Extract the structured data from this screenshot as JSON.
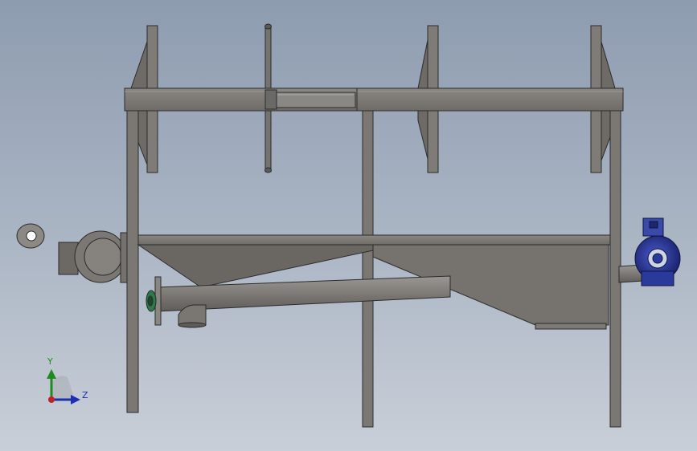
{
  "view": {
    "background_top": "#8e9cb0",
    "background_bottom": "#c9cfd8",
    "part_color": "#7d7a76",
    "part_edge": "#2b2b2b",
    "motor_color": "#2a3a9a",
    "flange_color": "#2e7a4a"
  },
  "triad": {
    "y_label": "Y",
    "z_label": "Z",
    "y_color": "#1f8a1f",
    "z_color": "#1c2fb0",
    "origin_color": "#c0202a"
  }
}
